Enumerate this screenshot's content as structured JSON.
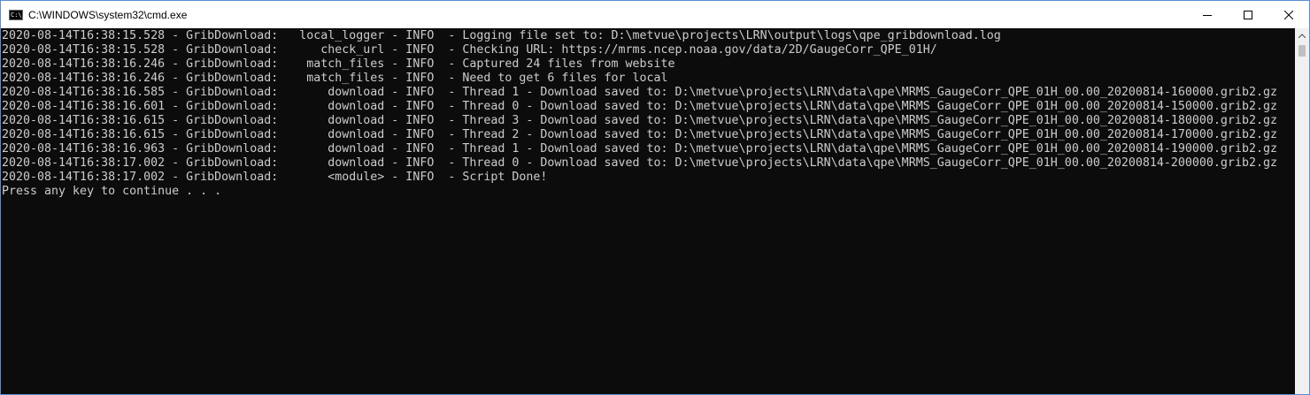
{
  "window": {
    "title": "C:\\WINDOWS\\system32\\cmd.exe"
  },
  "controls": {
    "minimize_icon": "minimize-icon",
    "maximize_icon": "maximize-icon",
    "close_icon": "close-icon"
  },
  "console": {
    "lines": [
      "2020-08-14T16:38:15.528 - GribDownload:   local_logger - INFO  - Logging file set to: D:\\metvue\\projects\\LRN\\output\\logs\\qpe_gribdownload.log",
      "2020-08-14T16:38:15.528 - GribDownload:      check_url - INFO  - Checking URL: https://mrms.ncep.noaa.gov/data/2D/GaugeCorr_QPE_01H/",
      "2020-08-14T16:38:16.246 - GribDownload:    match_files - INFO  - Captured 24 files from website",
      "2020-08-14T16:38:16.246 - GribDownload:    match_files - INFO  - Need to get 6 files for local",
      "2020-08-14T16:38:16.585 - GribDownload:       download - INFO  - Thread 1 - Download saved to: D:\\metvue\\projects\\LRN\\data\\qpe\\MRMS_GaugeCorr_QPE_01H_00.00_20200814-160000.grib2.gz",
      "2020-08-14T16:38:16.601 - GribDownload:       download - INFO  - Thread 0 - Download saved to: D:\\metvue\\projects\\LRN\\data\\qpe\\MRMS_GaugeCorr_QPE_01H_00.00_20200814-150000.grib2.gz",
      "2020-08-14T16:38:16.615 - GribDownload:       download - INFO  - Thread 3 - Download saved to: D:\\metvue\\projects\\LRN\\data\\qpe\\MRMS_GaugeCorr_QPE_01H_00.00_20200814-180000.grib2.gz",
      "2020-08-14T16:38:16.615 - GribDownload:       download - INFO  - Thread 2 - Download saved to: D:\\metvue\\projects\\LRN\\data\\qpe\\MRMS_GaugeCorr_QPE_01H_00.00_20200814-170000.grib2.gz",
      "2020-08-14T16:38:16.963 - GribDownload:       download - INFO  - Thread 1 - Download saved to: D:\\metvue\\projects\\LRN\\data\\qpe\\MRMS_GaugeCorr_QPE_01H_00.00_20200814-190000.grib2.gz",
      "2020-08-14T16:38:17.002 - GribDownload:       download - INFO  - Thread 0 - Download saved to: D:\\metvue\\projects\\LRN\\data\\qpe\\MRMS_GaugeCorr_QPE_01H_00.00_20200814-200000.grib2.gz",
      "2020-08-14T16:38:17.002 - GribDownload:       <module> - INFO  - Script Done!",
      "Press any key to continue . . ."
    ]
  },
  "colors": {
    "console_bg": "#0c0c0c",
    "console_fg": "#cccccc",
    "titlebar_bg": "#ffffff",
    "border_accent": "#5a8fd0"
  }
}
